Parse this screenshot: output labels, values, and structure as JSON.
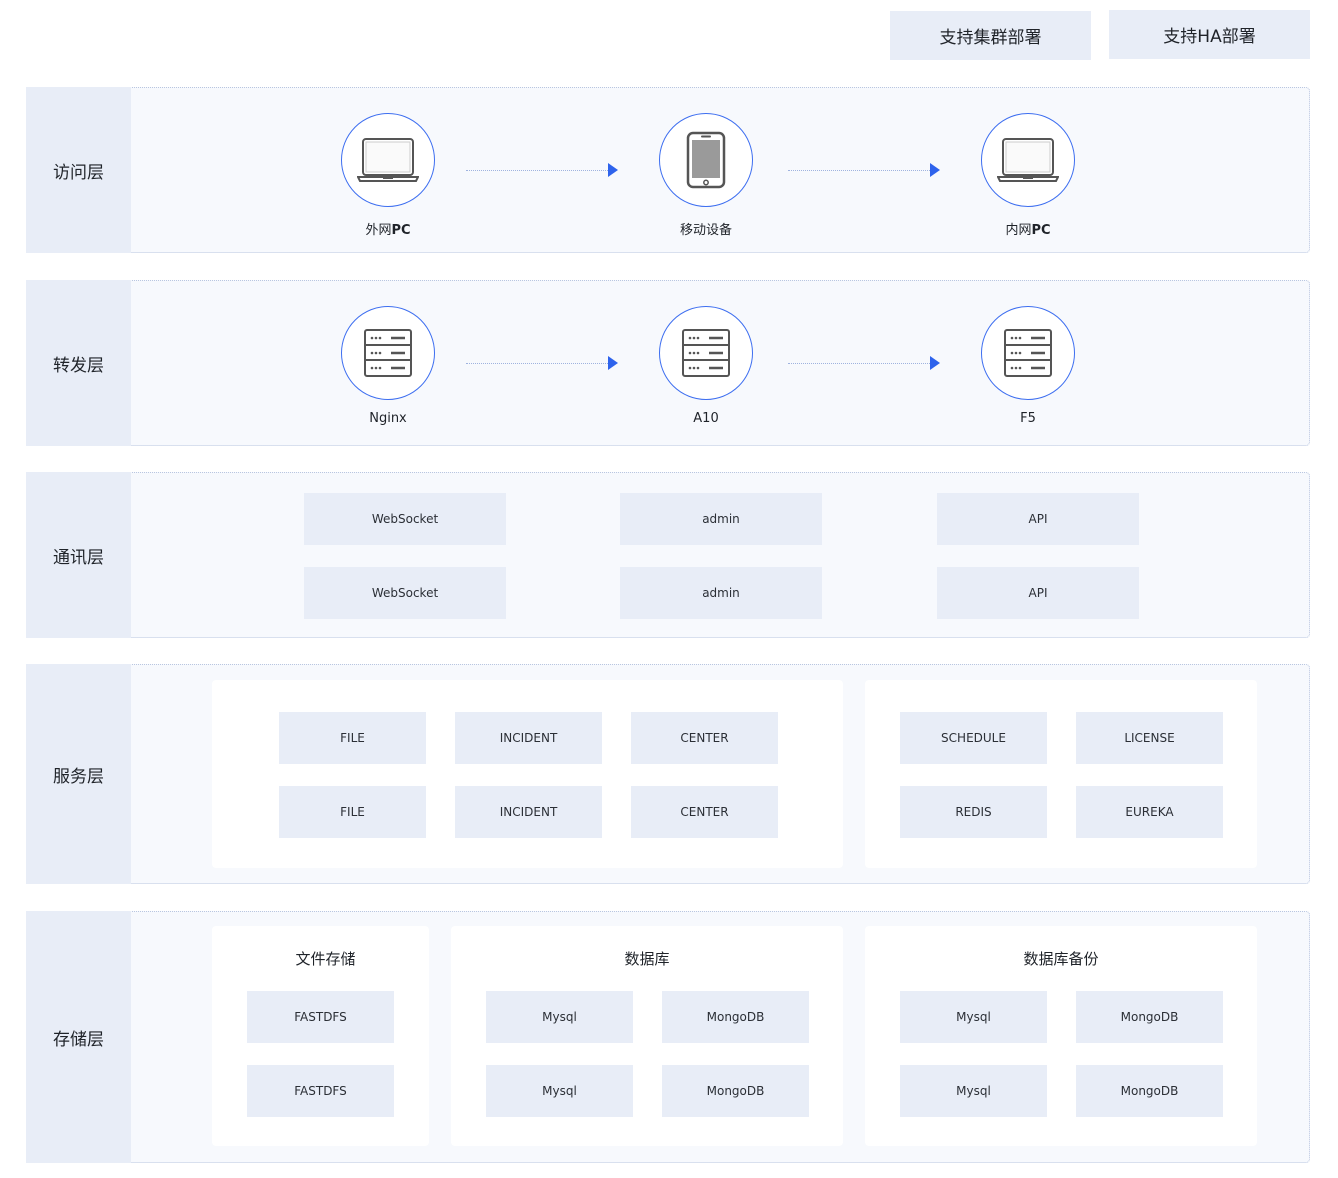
{
  "badges": [
    "支持集群部署",
    "支持HA部署"
  ],
  "layers": {
    "access": {
      "label": "访问层",
      "nodes": [
        {
          "name_prefix": "外网",
          "name_suffix": "PC",
          "icon": "laptop-icon"
        },
        {
          "name_prefix": "移动设备",
          "name_suffix": "",
          "icon": "mobile-icon"
        },
        {
          "name_prefix": "内网",
          "name_suffix": "PC",
          "icon": "laptop-icon"
        }
      ]
    },
    "forward": {
      "label": "转发层",
      "nodes": [
        {
          "name": "Nginx",
          "icon": "server-icon"
        },
        {
          "name": "A10",
          "icon": "server-icon"
        },
        {
          "name": "F5",
          "icon": "server-icon"
        }
      ]
    },
    "comm": {
      "label": "通讯层",
      "rows": [
        [
          "WebSocket",
          "admin",
          "API"
        ],
        [
          "WebSocket",
          "admin",
          "API"
        ]
      ]
    },
    "service": {
      "label": "服务层",
      "left_rows": [
        [
          "FILE",
          "INCIDENT",
          "CENTER"
        ],
        [
          "FILE",
          "INCIDENT",
          "CENTER"
        ]
      ],
      "right_rows": [
        [
          "SCHEDULE",
          "LICENSE"
        ],
        [
          "REDIS",
          "EUREKA"
        ]
      ]
    },
    "storage": {
      "label": "存储层",
      "panels": [
        {
          "title": "文件存储",
          "rows": [
            [
              "FASTDFS"
            ],
            [
              "FASTDFS"
            ]
          ]
        },
        {
          "title": "数据库",
          "rows": [
            [
              "Mysql",
              "MongoDB"
            ],
            [
              "Mysql",
              "MongoDB"
            ]
          ]
        },
        {
          "title": "数据库备份",
          "rows": [
            [
              "Mysql",
              "MongoDB"
            ],
            [
              "Mysql",
              "MongoDB"
            ]
          ]
        }
      ]
    }
  },
  "colors": {
    "accent": "#2e63ec",
    "chip": "#e8edf7",
    "layer_bg": "#f7f9fd"
  }
}
